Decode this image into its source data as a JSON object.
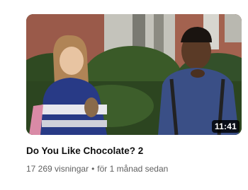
{
  "video": {
    "title": "Do You Like Chocolate? 2",
    "duration": "11:41",
    "views": "17 269 visningar",
    "separator": "•",
    "age": "för 1 månad sedan"
  },
  "thumbnail": {
    "description_icon": "video-thumbnail",
    "colors": {
      "sky": "#c9ccc6",
      "building": "#8a4a3c",
      "foliage": "#2f4a22",
      "woman_hoodie": "#283a86",
      "man_shirt": "#3a4f86"
    }
  }
}
